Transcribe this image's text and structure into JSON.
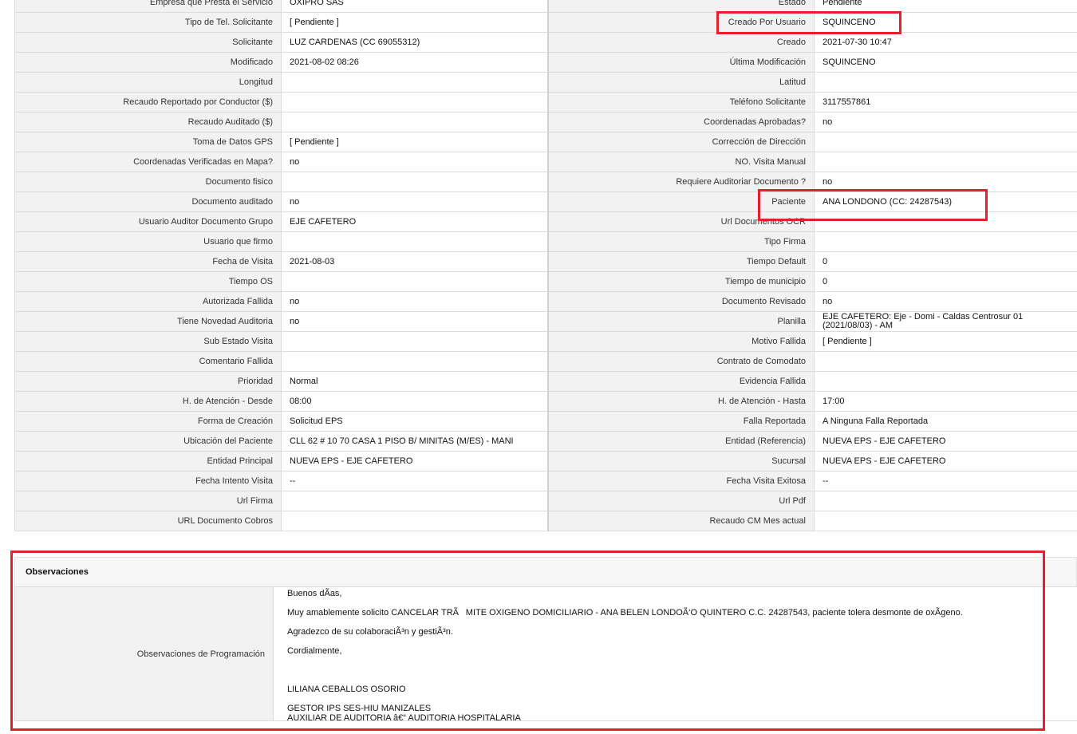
{
  "rows": [
    {
      "l1": "Empresa que Presta el Servicio",
      "v1": "OXIPRO SAS",
      "l2": "Estado",
      "v2": "Pendiente"
    },
    {
      "l1": "Tipo de Tel. Solicitante",
      "v1": "[ Pendiente ]",
      "l2": "Creado Por Usuario",
      "v2": "SQUINCENO"
    },
    {
      "l1": "Solicitante",
      "v1": "LUZ CARDENAS (CC 69055312)",
      "l2": "Creado",
      "v2": "2021-07-30 10:47"
    },
    {
      "l1": "Modificado",
      "v1": "2021-08-02 08:26",
      "l2": "Última Modificación",
      "v2": " SQUINCENO"
    },
    {
      "l1": "Longitud",
      "v1": "",
      "l2": "Latitud",
      "v2": ""
    },
    {
      "l1": "Recaudo Reportado por Conductor ($)",
      "v1": "",
      "l2": "Teléfono Solicitante",
      "v2": "3117557861"
    },
    {
      "l1": "Recaudo Auditado ($)",
      "v1": "",
      "l2": "Coordenadas Aprobadas?",
      "v2": " no"
    },
    {
      "l1": "Toma de Datos GPS",
      "v1": "[ Pendiente ]",
      "l2": "Corrección de Dirección",
      "v2": ""
    },
    {
      "l1": "Coordenadas Verificadas en Mapa?",
      "v1": " no",
      "l2": "NO. Visita Manual",
      "v2": ""
    },
    {
      "l1": "Documento fisico",
      "v1": "",
      "l2": "Requiere Auditoriar Documento ?",
      "v2": " no"
    },
    {
      "l1": "Documento auditado",
      "v1": " no",
      "l2": "Paciente",
      "v2": "ANA LONDONO (CC: 24287543)"
    },
    {
      "l1": "Usuario Auditor Documento Grupo",
      "v1": "EJE CAFETERO",
      "l2": "Url Documentos OCR",
      "v2": ""
    },
    {
      "l1": "Usuario que firmo",
      "v1": "",
      "l2": "Tipo Firma",
      "v2": ""
    },
    {
      "l1": "Fecha de Visita",
      "v1": " 2021-08-03",
      "l2": "Tiempo Default",
      "v2": "0"
    },
    {
      "l1": "Tiempo OS",
      "v1": "",
      "l2": "Tiempo de municipio",
      "v2": "0"
    },
    {
      "l1": "Autorizada Fallida",
      "v1": " no",
      "l2": "Documento Revisado",
      "v2": " no"
    },
    {
      "l1": "Tiene Novedad Auditoria",
      "v1": " no",
      "l2": "Planilla",
      "v2": "EJE CAFETERO: Eje - Domi - Caldas Centrosur 01 (2021/08/03) - AM"
    },
    {
      "l1": "Sub Estado Visita",
      "v1": "",
      "l2": "Motivo Fallida",
      "v2": "[ Pendiente ]"
    },
    {
      "l1": "Comentario Fallida",
      "v1": "",
      "l2": "Contrato de Comodato",
      "v2": ""
    },
    {
      "l1": "Prioridad",
      "v1": "Normal",
      "l2": "Evidencia Fallida",
      "v2": ""
    },
    {
      "l1": "H. de Atención - Desde",
      "v1": "08:00",
      "l2": "H. de Atención - Hasta",
      "v2": "17:00"
    },
    {
      "l1": "Forma de Creación",
      "v1": "Solicitud EPS",
      "l2": "Falla Reportada",
      "v2": "A Ninguna Falla Reportada"
    },
    {
      "l1": "Ubicación del Paciente",
      "v1": "CLL 62 # 10 70 CASA 1 PISO B/ MINITAS (M/ES) - MANI",
      "l2": "Entidad (Referencia)",
      "v2": "NUEVA EPS - EJE CAFETERO"
    },
    {
      "l1": "Entidad Principal",
      "v1": "NUEVA EPS - EJE CAFETERO",
      "l2": "Sucursal",
      "v2": "NUEVA EPS - EJE CAFETERO"
    },
    {
      "l1": "Fecha Intento Visita",
      "v1": " --",
      "l2": "Fecha Visita Exitosa",
      "v2": " --"
    },
    {
      "l1": "Url Firma",
      "v1": "",
      "l2": "Url Pdf",
      "v2": ""
    },
    {
      "l1": "URL Documento Cobros",
      "v1": "",
      "l2": "Recaudo CM Mes actual",
      "v2": ""
    }
  ],
  "observaciones": {
    "section_title": "Observaciones",
    "label": "Observaciones de Programación",
    "lines": [
      "Buenos dÃas,",
      "Muy amablemente solicito CANCELAR TRÃMITE OXIGENO DOMICILIARIO - ANA BELEN LONDOÃ‘O QUINTERO C.C. 24287543, paciente tolera desmonte de oxÃgeno.",
      "Agradezco de su colaboraciÃ³n y gestiÃ³n.",
      "Cordialmente,",
      "LILIANA CEBALLOS OSORIO",
      "GESTOR IPS SES-HIU MANIZALES",
      "AUXILIAR DE AUDITORIA â€“ AUDITORIA HOSPITALARIA"
    ]
  },
  "highlight_color": "#e3212b"
}
